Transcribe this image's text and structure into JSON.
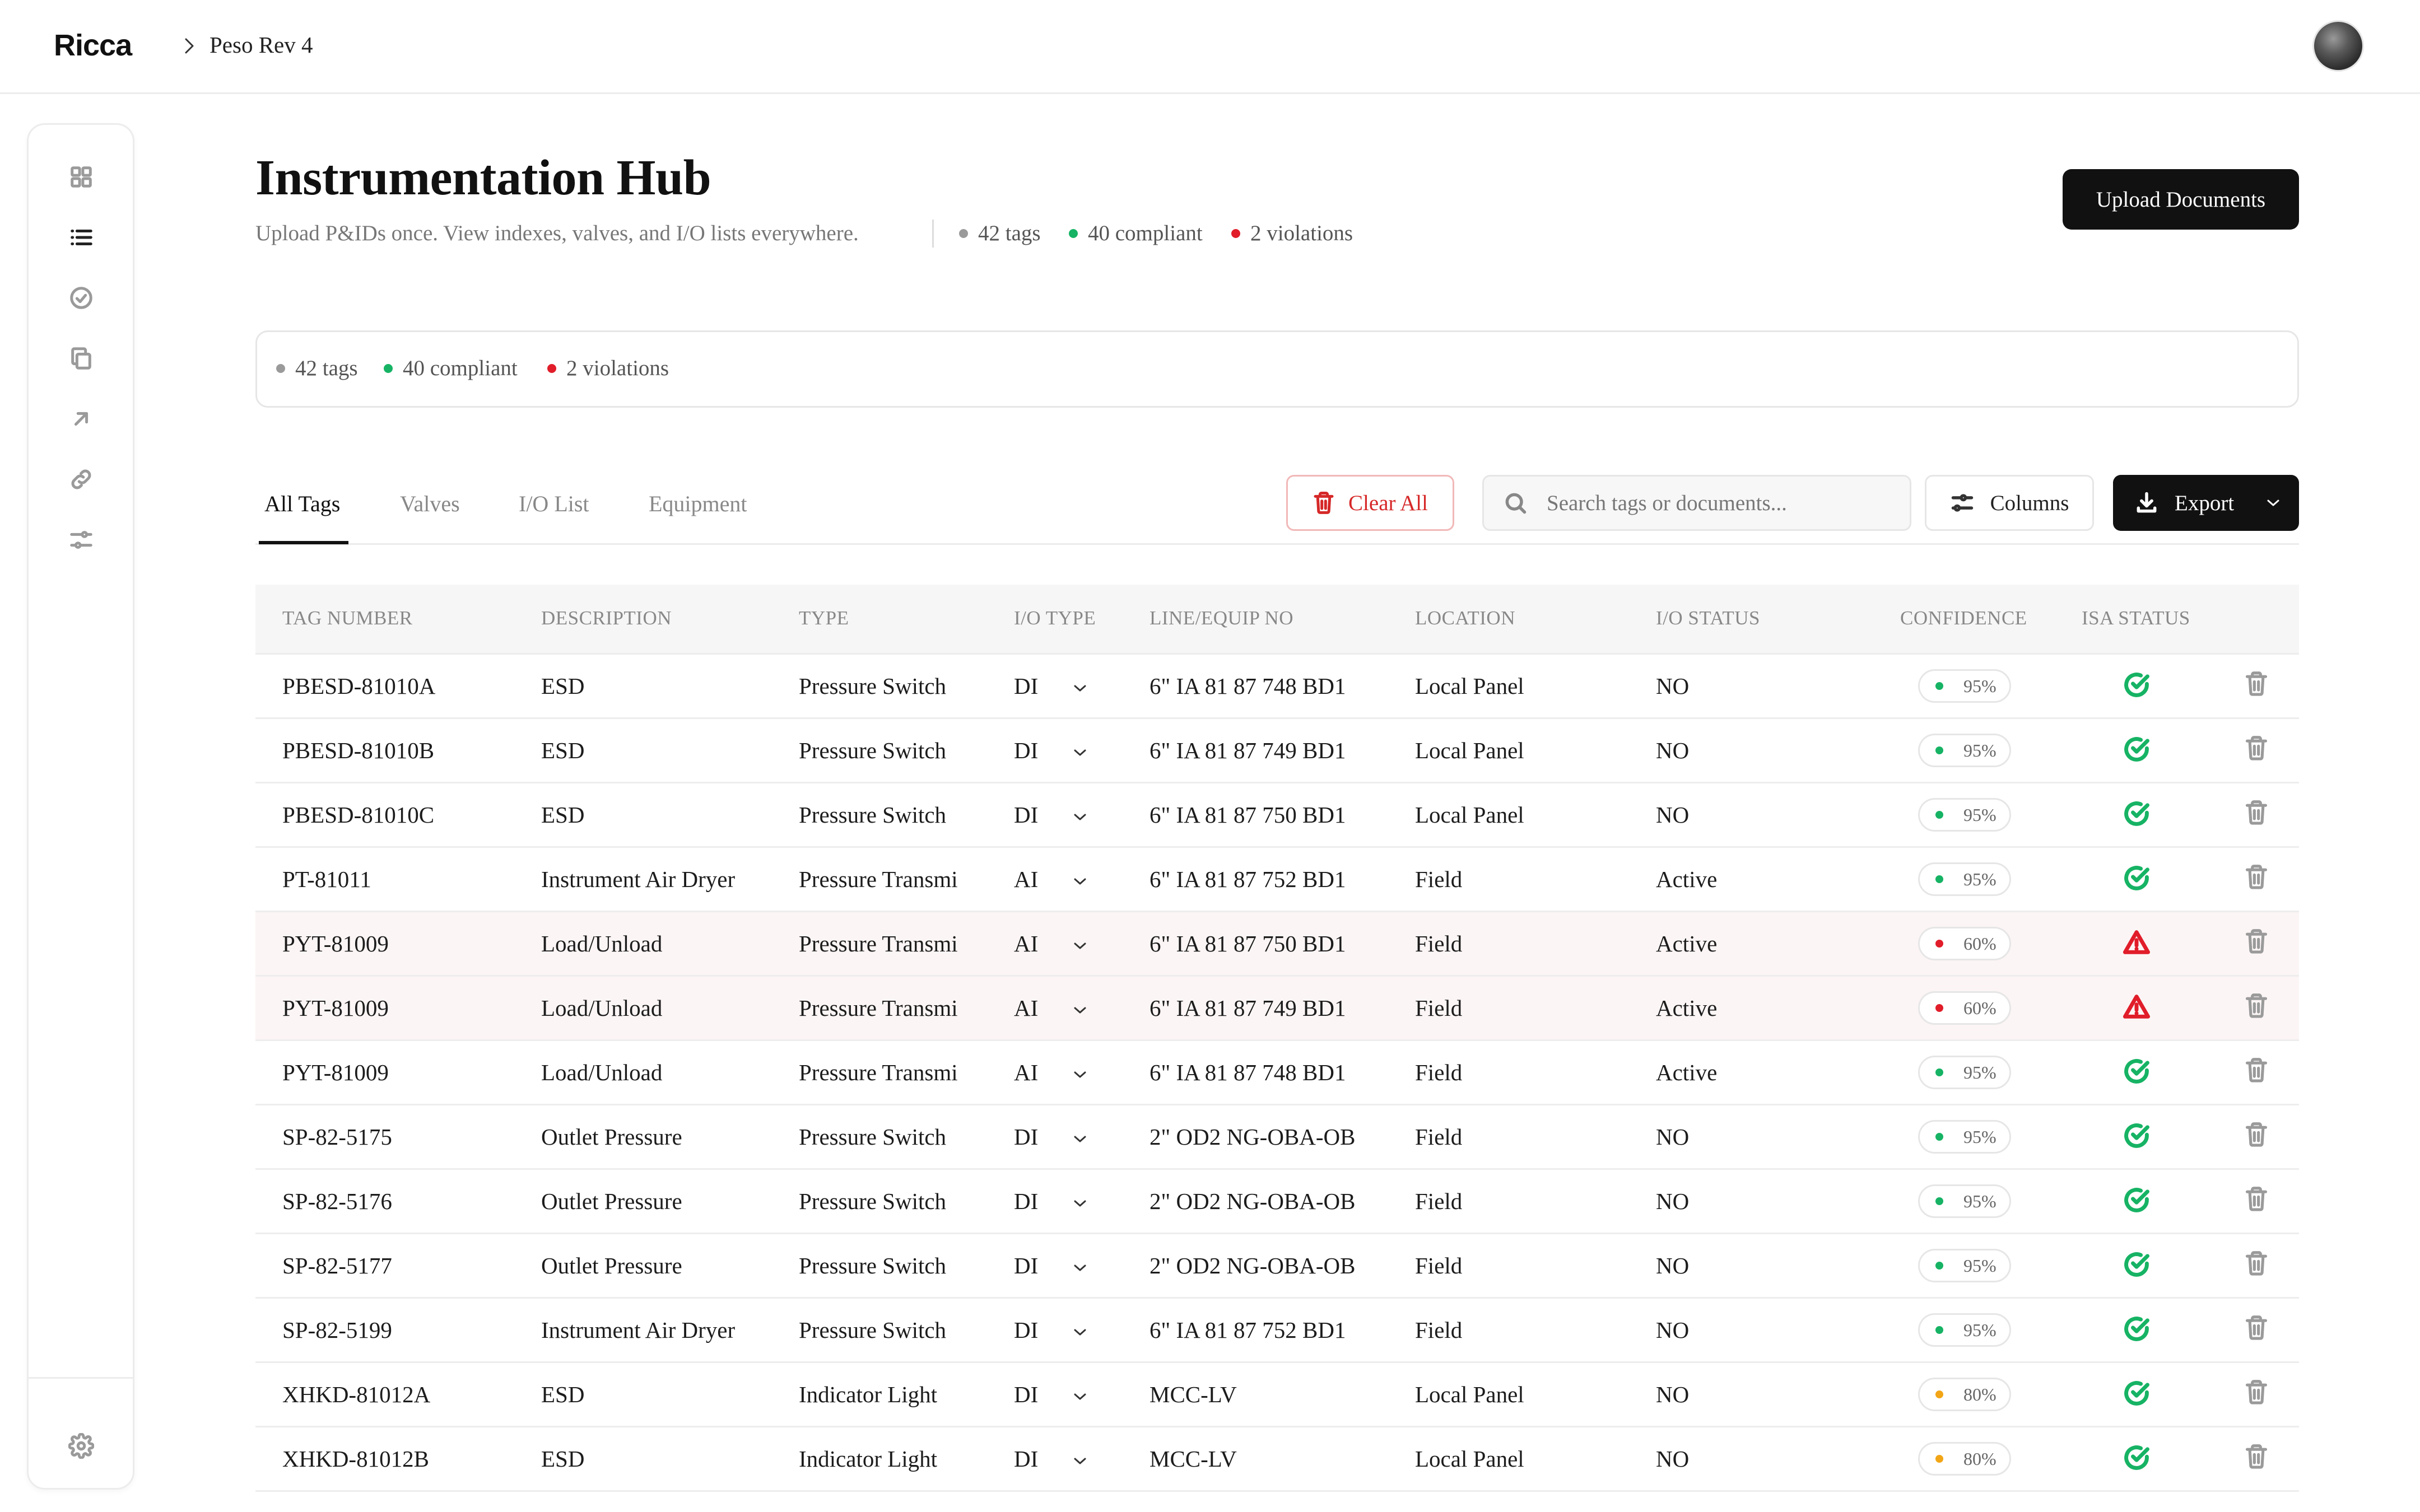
{
  "app": {
    "logo": "Ricca",
    "breadcrumb": "Peso Rev 4"
  },
  "header": {
    "title": "Instrumentation Hub",
    "subtitle": "Upload P&IDs once. View indexes, valves, and I/O lists everywhere.",
    "stats": {
      "tags": "42 tags",
      "compliant": "40 compliant",
      "violations": "2 violations"
    },
    "upload_label": "Upload Documents"
  },
  "summary": {
    "tags": "42 tags",
    "compliant": "40 compliant",
    "violations": "2 violations"
  },
  "tabs": [
    "All Tags",
    "Valves",
    "I/O List",
    "Equipment"
  ],
  "toolbar": {
    "clear_label": "Clear All",
    "search_placeholder": "Search tags or documents...",
    "columns_label": "Columns",
    "export_label": "Export"
  },
  "colors": {
    "compliant": "#16b364",
    "violation": "#e11d2a",
    "warning": "#f2a516",
    "neutral": "#9a9a9a"
  },
  "table": {
    "columns": [
      "TAG NUMBER",
      "DESCRIPTION",
      "TYPE",
      "I/O TYPE",
      "LINE/EQUIP NO",
      "LOCATION",
      "I/O STATUS",
      "CONFIDENCE",
      "ISA STATUS"
    ],
    "rows": [
      {
        "tag": "PBESD-81010A",
        "desc": "ESD",
        "type": "Pressure Switch",
        "io": "DI",
        "line": "6\" IA 81 87 748 BD1",
        "loc": "Local Panel",
        "status": "NO",
        "conf": "95%",
        "level": "ok",
        "isa": "ok"
      },
      {
        "tag": "PBESD-81010B",
        "desc": "ESD",
        "type": "Pressure Switch",
        "io": "DI",
        "line": "6\" IA 81 87 749 BD1",
        "loc": "Local Panel",
        "status": "NO",
        "conf": "95%",
        "level": "ok",
        "isa": "ok"
      },
      {
        "tag": "PBESD-81010C",
        "desc": "ESD",
        "type": "Pressure Switch",
        "io": "DI",
        "line": "6\" IA 81 87 750 BD1",
        "loc": "Local Panel",
        "status": "NO",
        "conf": "95%",
        "level": "ok",
        "isa": "ok"
      },
      {
        "tag": "PT-81011",
        "desc": "Instrument Air Dryer",
        "type": "Pressure Transmi",
        "io": "AI",
        "line": "6\" IA 81 87 752 BD1",
        "loc": "Field",
        "status": "Active",
        "conf": "95%",
        "level": "ok",
        "isa": "ok"
      },
      {
        "tag": "PYT-81009",
        "desc": "Load/Unload",
        "type": "Pressure Transmi",
        "io": "AI",
        "line": "6\" IA 81 87 750 BD1",
        "loc": "Field",
        "status": "Active",
        "conf": "60%",
        "level": "bad",
        "isa": "violation"
      },
      {
        "tag": "PYT-81009",
        "desc": "Load/Unload",
        "type": "Pressure Transmi",
        "io": "AI",
        "line": "6\" IA 81 87 749 BD1",
        "loc": "Field",
        "status": "Active",
        "conf": "60%",
        "level": "bad",
        "isa": "violation"
      },
      {
        "tag": "PYT-81009",
        "desc": "Load/Unload",
        "type": "Pressure Transmi",
        "io": "AI",
        "line": "6\" IA 81 87 748 BD1",
        "loc": "Field",
        "status": "Active",
        "conf": "95%",
        "level": "ok",
        "isa": "ok"
      },
      {
        "tag": "SP-82-5175",
        "desc": "Outlet Pressure",
        "type": "Pressure Switch",
        "io": "DI",
        "line": "2\" OD2 NG-OBA-OB",
        "loc": "Field",
        "status": "NO",
        "conf": "95%",
        "level": "ok",
        "isa": "ok"
      },
      {
        "tag": "SP-82-5176",
        "desc": "Outlet Pressure",
        "type": "Pressure Switch",
        "io": "DI",
        "line": "2\" OD2 NG-OBA-OB",
        "loc": "Field",
        "status": "NO",
        "conf": "95%",
        "level": "ok",
        "isa": "ok"
      },
      {
        "tag": "SP-82-5177",
        "desc": "Outlet Pressure",
        "type": "Pressure Switch",
        "io": "DI",
        "line": "2\" OD2 NG-OBA-OB",
        "loc": "Field",
        "status": "NO",
        "conf": "95%",
        "level": "ok",
        "isa": "ok"
      },
      {
        "tag": "SP-82-5199",
        "desc": "Instrument Air Dryer",
        "type": "Pressure Switch",
        "io": "DI",
        "line": "6\" IA 81 87 752 BD1",
        "loc": "Field",
        "status": "NO",
        "conf": "95%",
        "level": "ok",
        "isa": "ok"
      },
      {
        "tag": "XHKD-81012A",
        "desc": "ESD",
        "type": "Indicator Light",
        "io": "DI",
        "line": "MCC-LV",
        "loc": "Local Panel",
        "status": "NO",
        "conf": "80%",
        "level": "warn",
        "isa": "ok"
      },
      {
        "tag": "XHKD-81012B",
        "desc": "ESD",
        "type": "Indicator Light",
        "io": "DI",
        "line": "MCC-LV",
        "loc": "Local Panel",
        "status": "NO",
        "conf": "80%",
        "level": "warn",
        "isa": "ok"
      }
    ]
  },
  "sidebar": {
    "items": [
      {
        "icon": "grid-icon"
      },
      {
        "icon": "list-icon"
      },
      {
        "icon": "check-circle-icon"
      },
      {
        "icon": "copy-icon"
      },
      {
        "icon": "arrow-up-right-icon"
      },
      {
        "icon": "link-icon"
      },
      {
        "icon": "sliders-icon"
      }
    ],
    "settings_icon": "gear-icon"
  }
}
